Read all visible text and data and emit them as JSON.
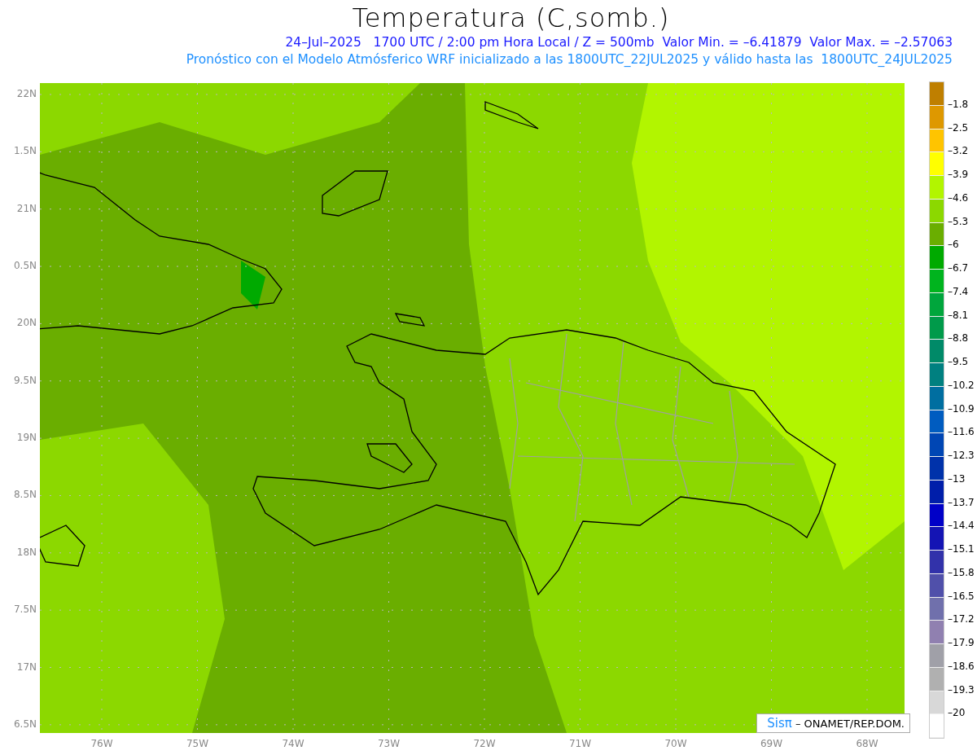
{
  "title": "Temperatura (C,somb.)",
  "subtitle_lines": [
    {
      "text": "24–Jul–2025   1700 UTC / 2:00 pm Hora Local / Z = 500mb  Valor Min. = –6.41879  Valor Max. = –2.57063",
      "color": "#1a1aff"
    },
    {
      "text": "Pronóstico con el Modelo Atmósferico WRF inicializado a las 1800UTC_22JUL2025 y válido hasta las  1800UTC_24JUL2025",
      "color": "#1e90ff"
    }
  ],
  "y_axis": [
    "22N",
    "1.5N",
    "21N",
    "0.5N",
    "20N",
    "9.5N",
    "19N",
    "8.5N",
    "18N",
    "7.5N",
    "17N",
    "6.5N"
  ],
  "x_axis": [
    "76W",
    "75W",
    "74W",
    "73W",
    "72W",
    "71W",
    "70W",
    "69W",
    "68W"
  ],
  "credit": {
    "logo": "Sisπ",
    "text": "– ONAMET/REP.DOM."
  },
  "legend": {
    "bins": [
      {
        "color": "#bf7f00"
      },
      {
        "color": "#de9800"
      },
      {
        "color": "#ffc400"
      },
      {
        "color": "#ffff00"
      },
      {
        "color": "#b2f500"
      },
      {
        "color": "#8cd800"
      },
      {
        "color": "#6aae00"
      },
      {
        "color": "#00aa00"
      },
      {
        "color": "#00b41e"
      },
      {
        "color": "#00a63c"
      },
      {
        "color": "#009a4a"
      },
      {
        "color": "#008a68"
      },
      {
        "color": "#008080"
      },
      {
        "color": "#006ea0"
      },
      {
        "color": "#005cc0"
      },
      {
        "color": "#0046b4"
      },
      {
        "color": "#0032aa"
      },
      {
        "color": "#001eaa"
      },
      {
        "color": "#0000c8"
      },
      {
        "color": "#1414b4"
      },
      {
        "color": "#3232aa"
      },
      {
        "color": "#5050aa"
      },
      {
        "color": "#7070ac"
      },
      {
        "color": "#9080b0"
      },
      {
        "color": "#a0a0a8"
      },
      {
        "color": "#b0b0b0"
      },
      {
        "color": "#d8d8d8"
      },
      {
        "color": "#ffffff"
      }
    ],
    "labels": [
      "–1.8",
      "–2.5",
      "–3.2",
      "–3.9",
      "–4.6",
      "–5.3",
      "–6",
      "–6.7",
      "–7.4",
      "–8.1",
      "–8.8",
      "–9.5",
      "–10.2",
      "–10.9",
      "–11.6",
      "–12.3",
      "–13",
      "–13.7",
      "–14.4",
      "–15.1",
      "–15.8",
      "–16.5",
      "–17.2",
      "–17.9",
      "–18.6",
      "–19.3",
      "–20"
    ]
  }
}
